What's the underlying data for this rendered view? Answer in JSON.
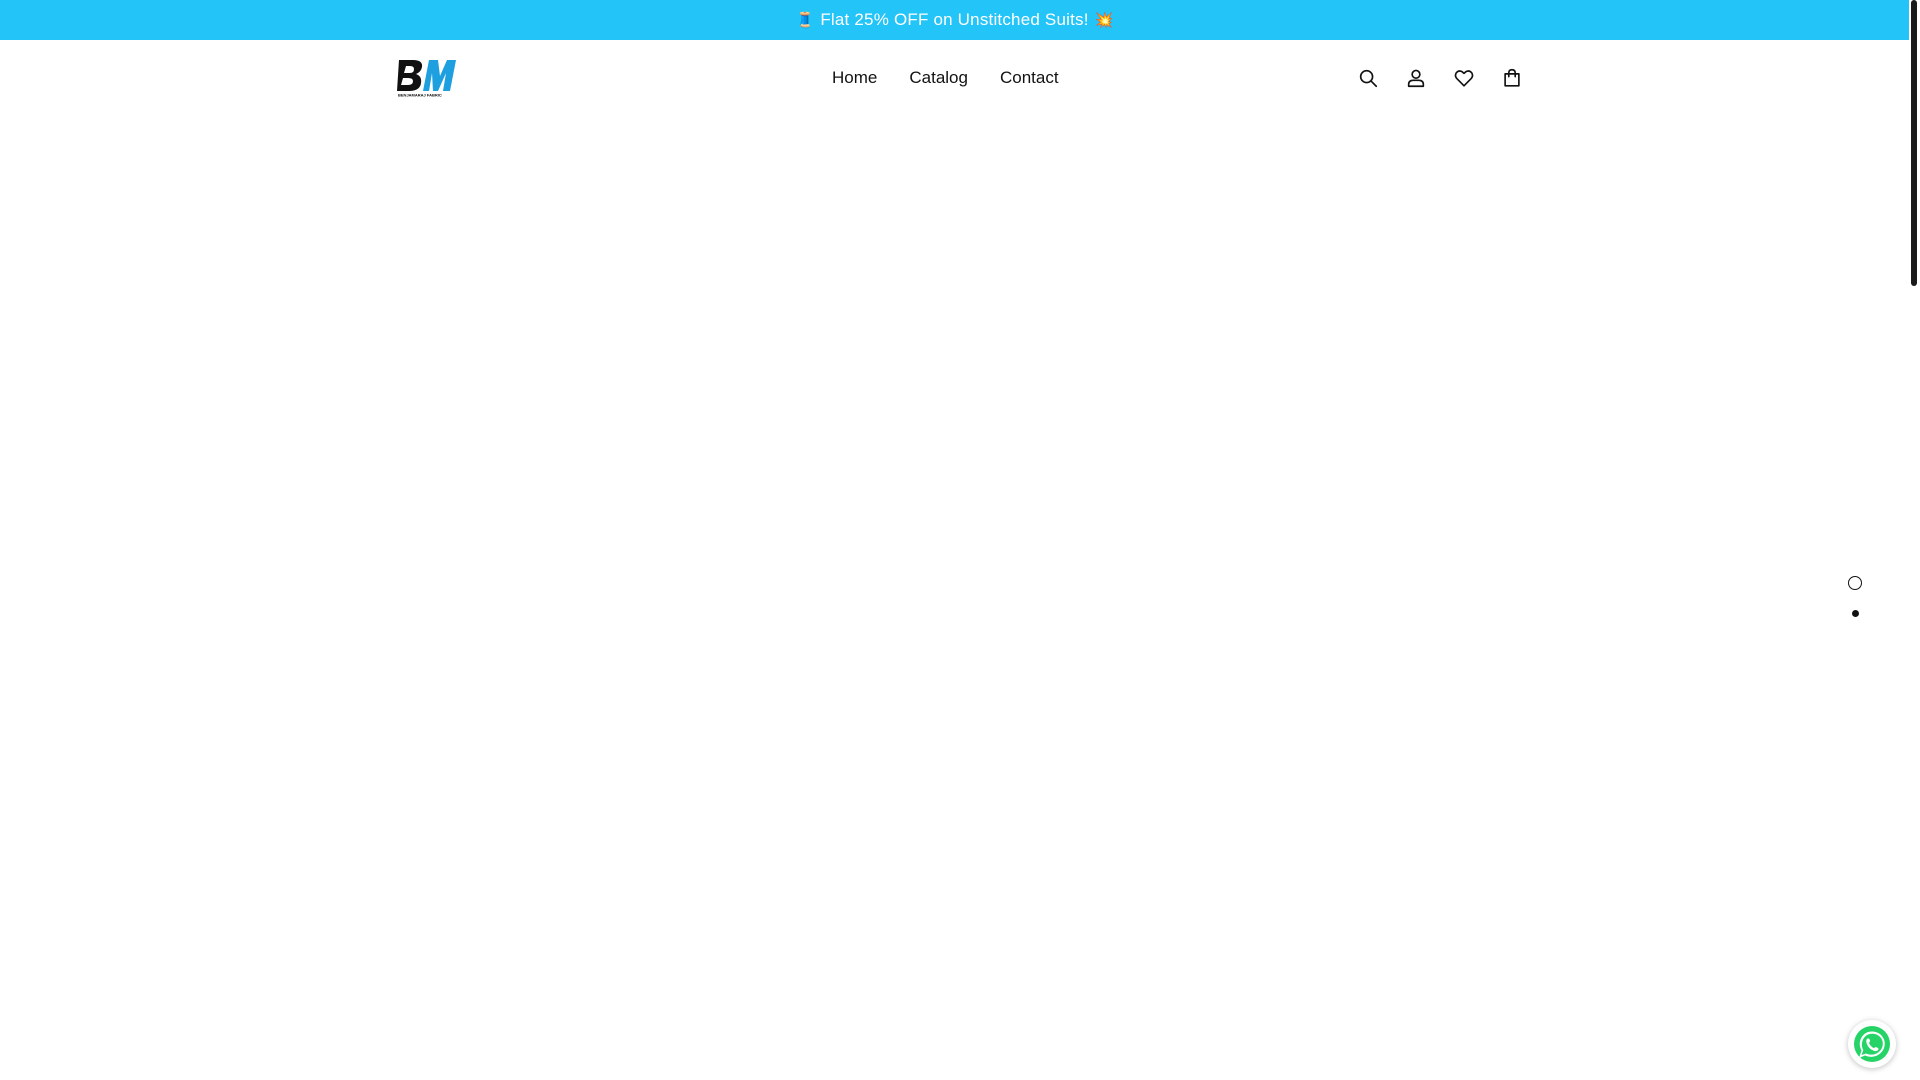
{
  "announcement": {
    "emoji_left": "🧵",
    "text": "Flat 25% OFF on Unstitched Suits!",
    "emoji_right": "💥"
  },
  "logo": {
    "text": "BM",
    "subtext": "BENJAMARAJ FABRIC",
    "colors": {
      "b": "#111111",
      "m": "#1e9fe0"
    }
  },
  "nav": {
    "items": [
      {
        "label": "Home"
      },
      {
        "label": "Catalog"
      },
      {
        "label": "Contact"
      }
    ]
  },
  "header_icons": [
    "search-icon",
    "account-icon",
    "wishlist-icon",
    "cart-icon"
  ],
  "slider": {
    "count": 2,
    "active_index": 1
  },
  "whatsapp": {
    "icon": "whatsapp-icon",
    "color": "#25d366"
  },
  "colors": {
    "announcement_bg": "#23c4f8",
    "text": "#121212"
  }
}
